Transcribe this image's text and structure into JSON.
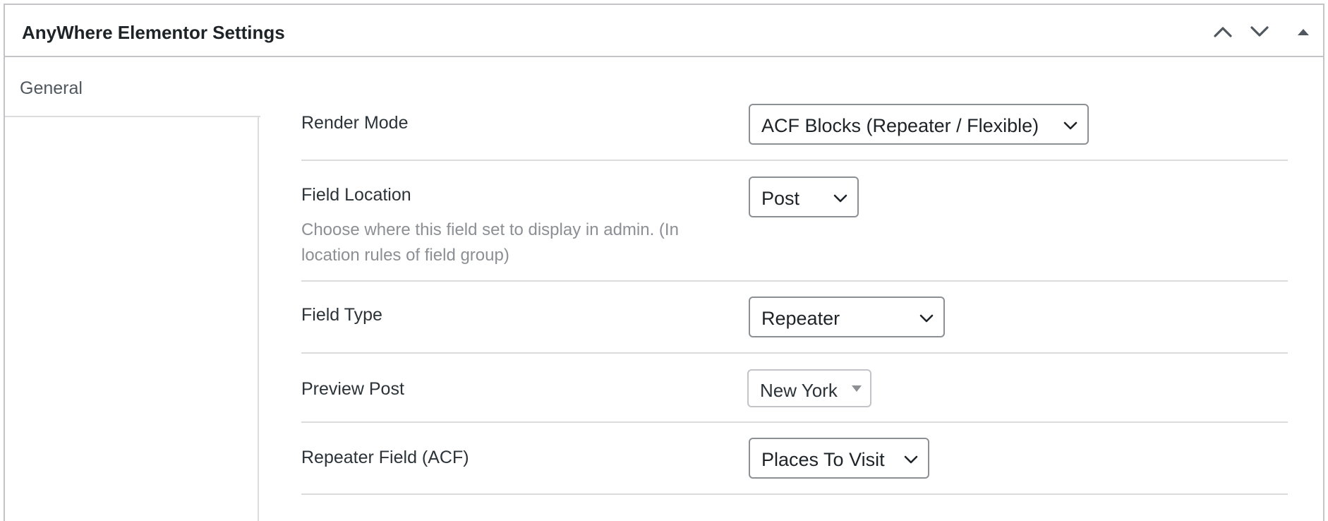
{
  "panel": {
    "title": "AnyWhere Elementor Settings",
    "controls": [
      "chevron-up-icon",
      "chevron-down-icon",
      "triangle-up-icon"
    ]
  },
  "tabs": [
    {
      "label": "General",
      "active": true
    }
  ],
  "fields": {
    "render_mode": {
      "label": "Render Mode",
      "value": "ACF Blocks (Repeater / Flexible)"
    },
    "field_location": {
      "label": "Field Location",
      "description": "Choose where this field set to display in admin. (In location rules of field group)",
      "value": "Post"
    },
    "field_type": {
      "label": "Field Type",
      "value": "Repeater"
    },
    "preview_post": {
      "label": "Preview Post",
      "value": "New York"
    },
    "repeater_field": {
      "label": "Repeater Field (ACF)",
      "value": "Places To Visit"
    }
  },
  "colors": {
    "border": "#c3c4c7",
    "divider": "#dcdcde",
    "text": "#1d2327",
    "muted": "#8c8f94"
  }
}
